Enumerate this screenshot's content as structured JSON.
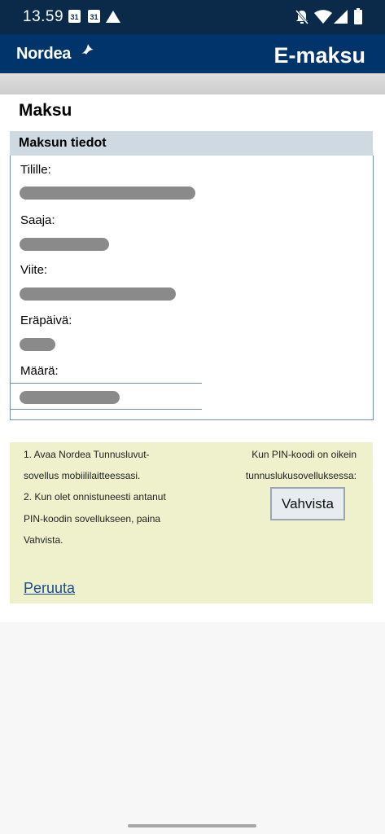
{
  "status_bar": {
    "time": "13.59",
    "calendar_day_1": "31",
    "calendar_day_2": "31"
  },
  "app_bar": {
    "logo_text": "Nordea",
    "title": "E-maksu",
    "brand_color": "#00346b"
  },
  "page": {
    "title": "Maksu"
  },
  "payment_details": {
    "header": "Maksun tiedot",
    "fields": [
      {
        "label": "Tilille:"
      },
      {
        "label": "Saaja:"
      },
      {
        "label": "Viite:"
      },
      {
        "label": "Eräpäivä:"
      },
      {
        "label": "Määrä:"
      }
    ]
  },
  "confirm_panel": {
    "instructions": [
      "1. Avaa Nordea Tunnusluvut-",
      "sovellus mobiililaitteessasi.",
      "2. Kun olet onnistuneesti antanut",
      "PIN-koodin sovellukseen, paina",
      "Vahvista."
    ],
    "right_text": [
      "Kun PIN-koodi on oikein",
      "tunnuslukusovelluksessa:"
    ],
    "confirm_label": "Vahvista",
    "cancel_label": "Peruuta",
    "panel_color": "#eef1cc"
  },
  "icons": [
    "calendar-icon",
    "warning-triangle-icon",
    "notifications-off-icon",
    "wifi-icon",
    "signal-icon",
    "battery-icon",
    "nordea-bird-logo"
  ]
}
